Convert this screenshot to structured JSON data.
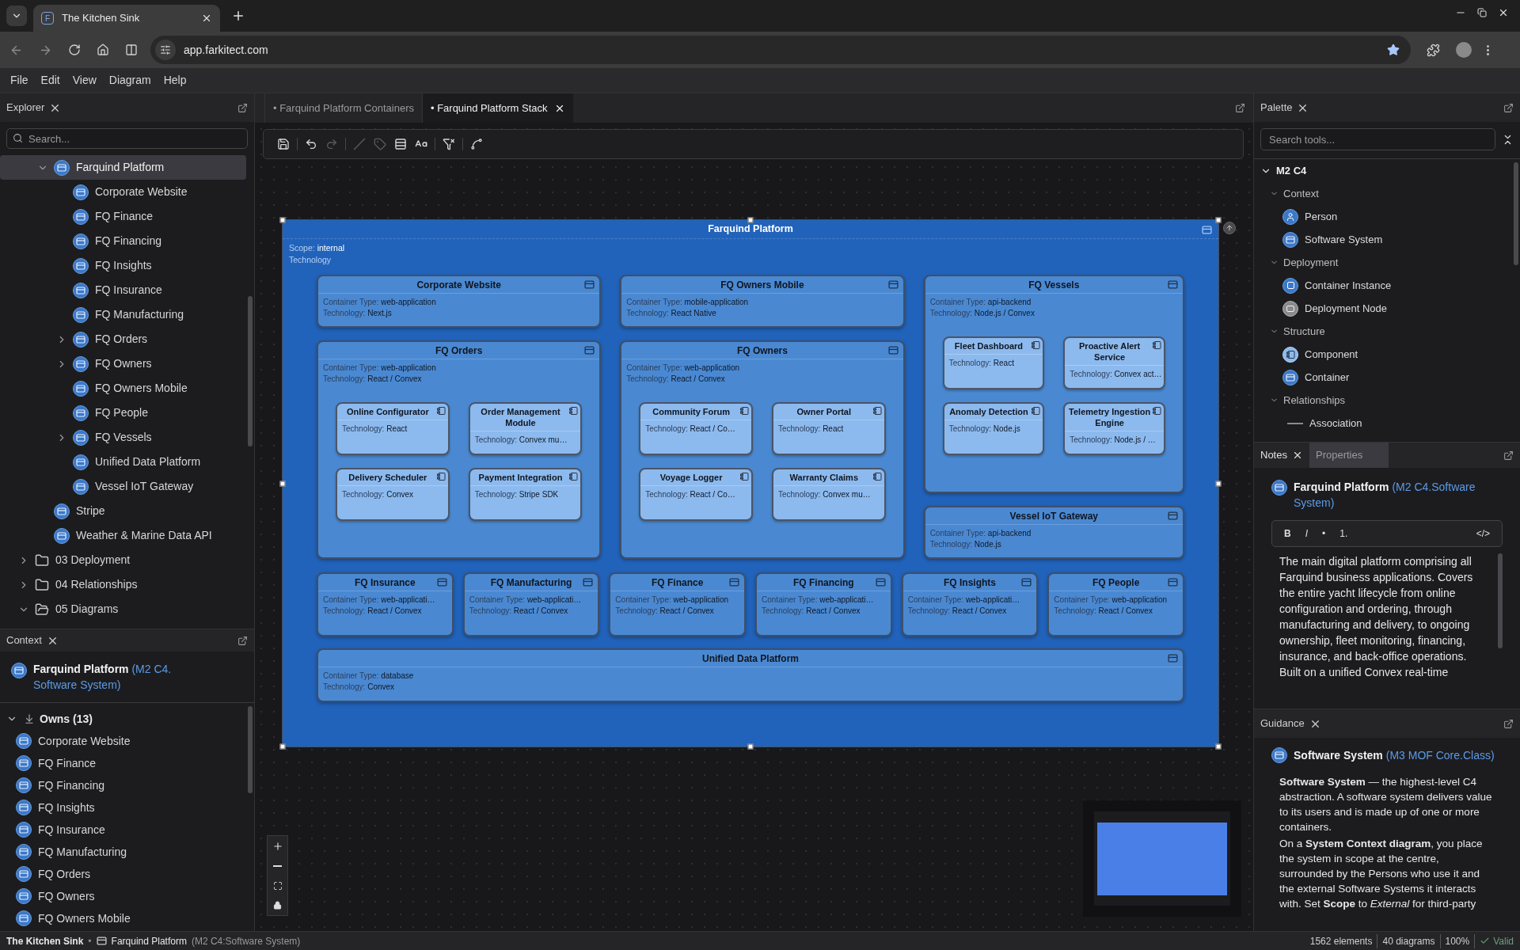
{
  "browser": {
    "favicon_letter": "F",
    "tab_title": "The Kitchen Sink",
    "url": "app.farkitect.com"
  },
  "menu": [
    "File",
    "Edit",
    "View",
    "Diagram",
    "Help"
  ],
  "explorer": {
    "title": "Explorer",
    "search_placeholder": "Search...",
    "tree": {
      "open_folder_items": [
        {
          "label": "Farquind Platform",
          "kind": "element",
          "expanded": true,
          "selected": true,
          "children": [
            {
              "label": "Corporate Website",
              "kind": "element",
              "selected": false
            },
            {
              "label": "FQ Finance",
              "kind": "element",
              "selected": false
            },
            {
              "label": "FQ Financing",
              "kind": "element",
              "selected": false
            },
            {
              "label": "FQ Insights",
              "kind": "element",
              "selected": false
            },
            {
              "label": "FQ Insurance",
              "kind": "element",
              "selected": false
            },
            {
              "label": "FQ Manufacturing",
              "kind": "element",
              "selected": false
            },
            {
              "label": "FQ Orders",
              "kind": "element",
              "expanded": false,
              "selected": false
            },
            {
              "label": "FQ Owners",
              "kind": "element",
              "expanded": false,
              "selected": false
            },
            {
              "label": "FQ Owners Mobile",
              "kind": "element",
              "selected": false
            },
            {
              "label": "FQ People",
              "kind": "element",
              "selected": false
            },
            {
              "label": "FQ Vessels",
              "kind": "element",
              "expanded": false,
              "selected": false
            },
            {
              "label": "Unified Data Platform",
              "kind": "element",
              "selected": false
            },
            {
              "label": "Vessel IoT Gateway",
              "kind": "element",
              "selected": false
            }
          ]
        },
        {
          "label": "Stripe",
          "kind": "element",
          "selected": false
        },
        {
          "label": "Weather & Marine Data API",
          "kind": "element",
          "selected": false
        }
      ],
      "folders": [
        {
          "label": "03 Deployment",
          "kind": "folder",
          "expanded": false,
          "selected": false
        },
        {
          "label": "04 Relationships",
          "kind": "folder",
          "expanded": false,
          "selected": false
        },
        {
          "label": "05 Diagrams",
          "kind": "folder",
          "expanded": true,
          "selected": false
        }
      ]
    }
  },
  "context": {
    "title": "Context",
    "entity": {
      "name": "Farquind Platform",
      "type": "(M2 C4. Software System)"
    },
    "owns": {
      "label": "Owns (13)",
      "expanded": true,
      "items": [
        "Corporate Website",
        "FQ Finance",
        "FQ Financing",
        "FQ Insights",
        "FQ Insurance",
        "FQ Manufacturing",
        "FQ Orders",
        "FQ Owners",
        "FQ Owners Mobile"
      ]
    }
  },
  "editor_tabs": [
    {
      "label": "• Farquind Platform Containers",
      "selected": false
    },
    {
      "label": "• Farquind Platform Stack",
      "selected": true
    }
  ],
  "toolbar": [
    [
      {
        "kind": "save",
        "disabled": false
      }
    ],
    [
      {
        "kind": "undo",
        "disabled": false
      },
      {
        "kind": "redo",
        "disabled": true
      }
    ],
    [
      {
        "kind": "line",
        "disabled": true
      },
      {
        "kind": "tag",
        "disabled": true
      },
      {
        "kind": "rows",
        "disabled": false
      },
      {
        "kind": "text-style",
        "disabled": false
      }
    ],
    [
      {
        "kind": "filter-clear",
        "disabled": false
      }
    ],
    [
      {
        "kind": "connector",
        "disabled": false
      }
    ]
  ],
  "diagram": {
    "title": "Farquind Platform",
    "scope_label": "Scope:",
    "scope_value": "internal",
    "technology_label": "Technology",
    "columns": [
      [
        {
          "name": "Corporate Website",
          "fields": [
            {
              "label": "Container Type:",
              "value": "web-application"
            },
            {
              "label": "Technology:",
              "value": "Next.js"
            }
          ]
        },
        {
          "name": "FQ Orders",
          "fields": [
            {
              "label": "Container Type:",
              "value": "web-application"
            },
            {
              "label": "Technology:",
              "value": "React / Convex"
            }
          ],
          "components": [
            {
              "name": "Online Configurator",
              "fields": [
                {
                  "label": "Technology:",
                  "value": "React"
                }
              ]
            },
            {
              "name": "Order Management Module",
              "fields": [
                {
                  "label": "Technology:",
                  "value": "Convex mu…"
                }
              ]
            },
            {
              "name": "Delivery Scheduler",
              "fields": [
                {
                  "label": "Technology:",
                  "value": "Convex"
                }
              ]
            },
            {
              "name": "Payment Integration",
              "fields": [
                {
                  "label": "Technology:",
                  "value": "Stripe SDK"
                }
              ]
            }
          ]
        }
      ],
      [
        {
          "name": "FQ Owners Mobile",
          "fields": [
            {
              "label": "Container Type:",
              "value": "mobile-application"
            },
            {
              "label": "Technology:",
              "value": "React Native"
            }
          ]
        },
        {
          "name": "FQ Owners",
          "fields": [
            {
              "label": "Container Type:",
              "value": "web-application"
            },
            {
              "label": "Technology:",
              "value": "React / Convex"
            }
          ],
          "components": [
            {
              "name": "Community Forum",
              "fields": [
                {
                  "label": "Technology:",
                  "value": "React / Co…"
                }
              ]
            },
            {
              "name": "Owner Portal",
              "fields": [
                {
                  "label": "Technology:",
                  "value": "React"
                }
              ]
            },
            {
              "name": "Voyage Logger",
              "fields": [
                {
                  "label": "Technology:",
                  "value": "React / Co…"
                }
              ]
            },
            {
              "name": "Warranty Claims",
              "fields": [
                {
                  "label": "Technology:",
                  "value": "Convex mu…"
                }
              ]
            }
          ]
        }
      ],
      [
        {
          "name": "FQ Vessels",
          "fields": [
            {
              "label": "Container Type:",
              "value": "api-backend"
            },
            {
              "label": "Technology:",
              "value": "Node.js / Convex"
            }
          ],
          "components": [
            {
              "name": "Fleet Dashboard",
              "fields": [
                {
                  "label": "Technology:",
                  "value": "React"
                }
              ]
            },
            {
              "name": "Proactive Alert Service",
              "fields": [
                {
                  "label": "Technology:",
                  "value": "Convex act…"
                }
              ]
            },
            {
              "name": "Anomaly Detection",
              "fields": [
                {
                  "label": "Technology:",
                  "value": "Node.js"
                }
              ]
            },
            {
              "name": "Telemetry Ingestion Engine",
              "fields": [
                {
                  "label": "Technology:",
                  "value": "Node.js / …"
                }
              ]
            }
          ]
        },
        {
          "name": "Vessel IoT Gateway",
          "fields": [
            {
              "label": "Container Type:",
              "value": "api-backend"
            },
            {
              "label": "Technology:",
              "value": "Node.js"
            }
          ]
        }
      ]
    ],
    "row": [
      {
        "name": "FQ Insurance",
        "fields": [
          {
            "label": "Container Type:",
            "value": "web-applicati…"
          },
          {
            "label": "Technology:",
            "value": "React / Convex"
          }
        ]
      },
      {
        "name": "FQ Manufacturing",
        "fields": [
          {
            "label": "Container Type:",
            "value": "web-applicati…"
          },
          {
            "label": "Technology:",
            "value": "React / Convex"
          }
        ]
      },
      {
        "name": "FQ Finance",
        "fields": [
          {
            "label": "Container Type:",
            "value": "web-application"
          },
          {
            "label": "Technology:",
            "value": "React / Convex"
          }
        ]
      },
      {
        "name": "FQ Financing",
        "fields": [
          {
            "label": "Container Type:",
            "value": "web-applicati…"
          },
          {
            "label": "Technology:",
            "value": "React / Convex"
          }
        ]
      },
      {
        "name": "FQ Insights",
        "fields": [
          {
            "label": "Container Type:",
            "value": "web-applicati…"
          },
          {
            "label": "Technology:",
            "value": "React / Convex"
          }
        ]
      },
      {
        "name": "FQ People",
        "fields": [
          {
            "label": "Container Type:",
            "value": "web-application"
          },
          {
            "label": "Technology:",
            "value": "React / Convex"
          }
        ]
      }
    ],
    "footer": [
      {
        "name": "Unified Data Platform",
        "fields": [
          {
            "label": "Container Type:",
            "value": "database"
          },
          {
            "label": "Technology:",
            "value": "Convex"
          }
        ]
      }
    ]
  },
  "palette": {
    "title": "Palette",
    "search_placeholder": "Search tools...",
    "group": {
      "label": "M2 C4",
      "expanded": true,
      "children": [
        {
          "label": "Context",
          "expanded": true,
          "children": [
            {
              "label": "Person",
              "kind": "person"
            },
            {
              "label": "Software System",
              "kind": "system"
            }
          ]
        },
        {
          "label": "Deployment",
          "expanded": true,
          "children": [
            {
              "label": "Container Instance",
              "kind": "instance"
            },
            {
              "label": "Deployment Node",
              "kind": "node"
            }
          ]
        },
        {
          "label": "Structure",
          "expanded": true,
          "children": [
            {
              "label": "Component",
              "kind": "component"
            },
            {
              "label": "Container",
              "kind": "container"
            }
          ]
        },
        {
          "label": "Relationships",
          "expanded": true,
          "children": [
            {
              "label": "Association",
              "kind": "association"
            }
          ]
        }
      ]
    }
  },
  "notes": {
    "tabs": [
      {
        "label": "Notes",
        "selected": true
      },
      {
        "label": "Properties",
        "selected": false
      }
    ],
    "name": "Farquind Platform",
    "type": "(M2 C4.Software System)",
    "format_buttons": [
      "B",
      "I",
      "•",
      "1.",
      "</>"
    ],
    "text": "The main digital platform comprising all Farquind business applications. Covers the entire yacht lifecycle from online configuration and ordering, through manufacturing and delivery, to ongoing ownership, fleet monitoring, financing, insurance, and back-office operations. Built on a unified Convex real-time"
  },
  "guidance": {
    "title": "Guidance",
    "name": "Software System",
    "type": "(M3 MOF Core.Class)",
    "paragraphs": [
      "**Software System** — the highest-level C4 abstraction. A software system delivers value to its users and is made up of one or more containers.",
      "On a **System Context diagram**, you place the system in scope at the centre, surrounded by the Persons who use it and the external Software Systems it interacts with. Set **Scope** to *External* for third-party"
    ]
  },
  "status_bar": {
    "workspace": "The Kitchen Sink",
    "separator": "•",
    "element": "Farquind Platform",
    "element_type": "(M2 C4:Software System)",
    "stats": [
      "1562 elements",
      "40 diagrams",
      "100%"
    ],
    "validity": "Valid"
  }
}
